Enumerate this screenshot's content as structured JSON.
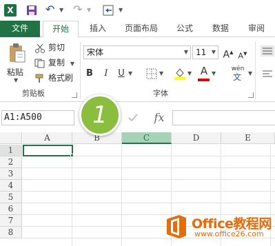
{
  "quick_access": {
    "icons": [
      "excel-logo",
      "save-icon",
      "undo-icon",
      "redo-icon",
      "customize-icon"
    ]
  },
  "tabs": [
    {
      "label": "文件"
    },
    {
      "label": "开始"
    },
    {
      "label": "插入"
    },
    {
      "label": "页面布局"
    },
    {
      "label": "公式"
    },
    {
      "label": "数据"
    },
    {
      "label": "审阅"
    }
  ],
  "ribbon": {
    "clipboard": {
      "paste_label": "粘贴",
      "cut_label": "剪切",
      "copy_label": "复制",
      "format_painter_label": "格式刷",
      "group_label": "剪贴板"
    },
    "font": {
      "font_name": "宋体",
      "font_size": "11",
      "bold": "B",
      "italic": "I",
      "underline": "U",
      "font_color_glyph": "A",
      "group_label": "字体",
      "grow_glyph": "A",
      "shrink_glyph": "A",
      "phonetic_glyph": "wén"
    }
  },
  "formula_bar": {
    "name_box": "A1:A500",
    "fx_label": "fx",
    "formula_value": ""
  },
  "grid": {
    "columns": [
      "A",
      "B",
      "C",
      "D",
      "E"
    ],
    "selected_column": "C",
    "rows": [
      "1",
      "2",
      "3",
      "4",
      "5",
      "6",
      "7",
      "8"
    ]
  },
  "callout": {
    "number": "1"
  },
  "watermark": {
    "title": "Office教程网",
    "url": "www.office26.com"
  },
  "colors": {
    "excel_green": "#217346",
    "callout_green": "#8bbd3f",
    "watermark_orange": "#e46c0a"
  }
}
